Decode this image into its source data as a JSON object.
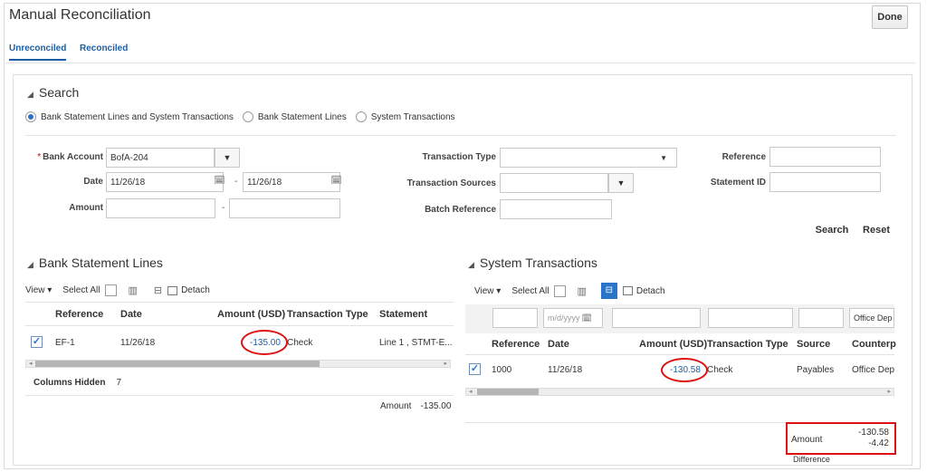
{
  "page": {
    "title": "Manual Reconciliation",
    "done_label": "Done"
  },
  "tabs": [
    {
      "label": "Unreconciled"
    },
    {
      "label": "Reconciled"
    }
  ],
  "search": {
    "heading": "Search",
    "radios": [
      {
        "label": "Bank Statement Lines and System Transactions",
        "selected": true
      },
      {
        "label": "Bank Statement Lines",
        "selected": false
      },
      {
        "label": "System Transactions",
        "selected": false
      }
    ],
    "bank_account_label": "Bank Account",
    "bank_account_value": "BofA-204",
    "date_label": "Date",
    "date_from": "11/26/18",
    "date_to": "11/26/18",
    "amount_label": "Amount",
    "range_dash": "-",
    "transaction_type_label": "Transaction Type",
    "transaction_sources_label": "Transaction Sources",
    "batch_reference_label": "Batch Reference",
    "reference_label": "Reference",
    "statement_id_label": "Statement ID",
    "search_label": "Search",
    "reset_label": "Reset"
  },
  "bank_lines": {
    "heading": "Bank Statement Lines",
    "view_label": "View",
    "select_all_label": "Select All",
    "detach_label": "Detach",
    "columns": [
      "Reference",
      "Date",
      "Amount (USD)",
      "Transaction Type",
      "Statement"
    ],
    "rows": [
      {
        "checked": true,
        "reference": "EF-1",
        "date": "11/26/18",
        "amount": "-135.00",
        "type": "Check",
        "statement": "Line 1 , STMT-E..."
      }
    ],
    "columns_hidden_label": "Columns Hidden",
    "columns_hidden_value": "7",
    "amount_label": "Amount",
    "amount_total": "-135.00"
  },
  "system_tx": {
    "heading": "System Transactions",
    "view_label": "View",
    "select_all_label": "Select All",
    "detach_label": "Detach",
    "date_filter_placeholder": "m/d/yyyy",
    "counterparty_filter": "Office Dep",
    "columns": [
      "Reference",
      "Date",
      "Amount (USD)",
      "Transaction Type",
      "Source",
      "Counterp"
    ],
    "rows": [
      {
        "checked": true,
        "reference": "1000",
        "date": "11/26/18",
        "amount": "-130.58",
        "type": "Check",
        "source": "Payables",
        "counterparty": "Office Dep"
      }
    ],
    "amount_label": "Amount",
    "amount_total": "-130.58",
    "difference_label": "Difference",
    "difference_value": "-4.42"
  },
  "colors": {
    "link": "#1a5fa5",
    "highlight": "#dd1111",
    "accent": "#2a73c6"
  }
}
